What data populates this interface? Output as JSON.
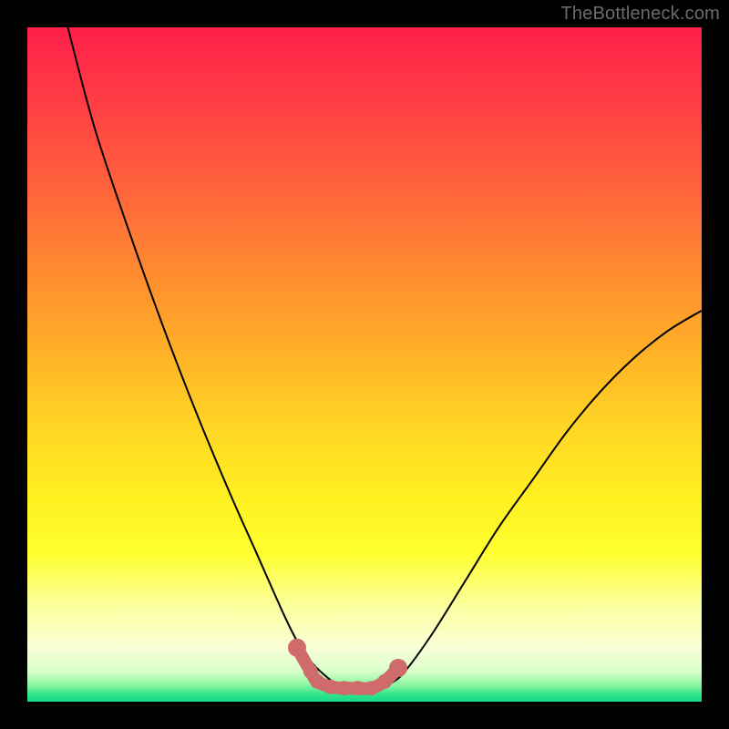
{
  "watermark": "TheBottleneck.com",
  "chart_data": {
    "type": "line",
    "title": "",
    "xlabel": "",
    "ylabel": "",
    "xlim": [
      0,
      100
    ],
    "ylim": [
      0,
      100
    ],
    "background_gradient": {
      "stops": [
        {
          "pos": 0,
          "color": "#ff1f4a"
        },
        {
          "pos": 26,
          "color": "#ff6a3a"
        },
        {
          "pos": 48,
          "color": "#ffb028"
        },
        {
          "pos": 70,
          "color": "#fff020"
        },
        {
          "pos": 86,
          "color": "#fcffa0"
        },
        {
          "pos": 96,
          "color": "#b7f6b0"
        },
        {
          "pos": 100,
          "color": "#17d98a"
        }
      ]
    },
    "series": [
      {
        "name": "bottleneck-curve",
        "color": "#000000",
        "x": [
          6,
          10,
          15,
          20,
          25,
          30,
          34,
          38,
          40,
          42,
          44,
          46,
          48,
          50,
          52,
          54,
          56,
          60,
          65,
          70,
          75,
          80,
          85,
          90,
          95,
          100
        ],
        "y": [
          100,
          85,
          70,
          56,
          43,
          31,
          22,
          13,
          9,
          6,
          4,
          2.5,
          2,
          2,
          2,
          2.8,
          4.5,
          10,
          18,
          26,
          33,
          40,
          46,
          51,
          55,
          58
        ]
      },
      {
        "name": "sweet-spot-markers",
        "color": "#cf6b6b",
        "type": "scatter",
        "x": [
          40,
          42,
          43,
          45,
          47,
          49,
          51,
          53,
          55
        ],
        "y": [
          8,
          4.5,
          3,
          2.2,
          2,
          2,
          2,
          3,
          5
        ]
      }
    ],
    "sweet_spot_range": {
      "xmin": 42,
      "xmax": 55
    }
  }
}
